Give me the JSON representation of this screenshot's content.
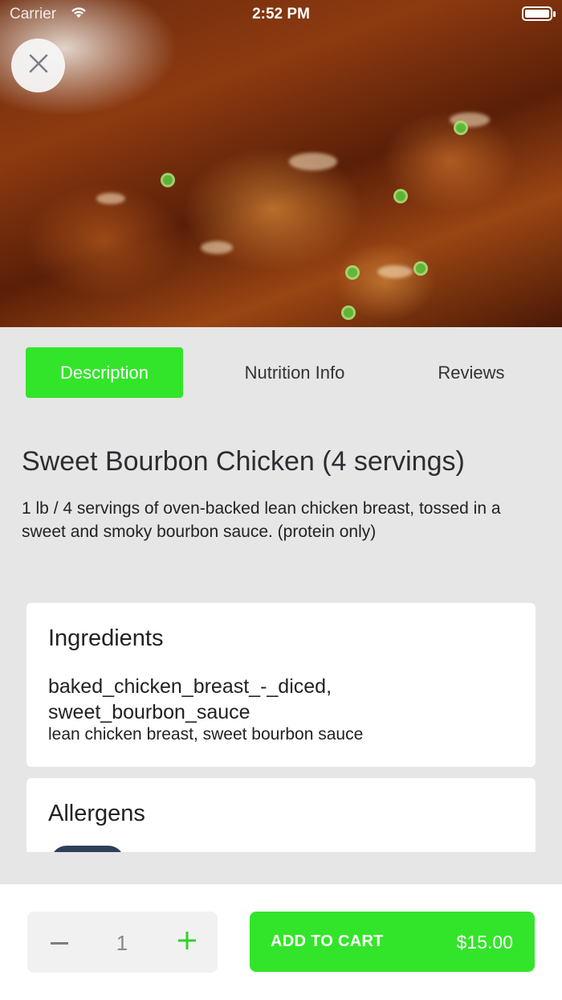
{
  "status_bar": {
    "carrier": "Carrier",
    "time": "2:52 PM"
  },
  "hero": {
    "icon": "food-photo"
  },
  "close_icon": "close-icon",
  "tabs": [
    {
      "label": "Description",
      "active": true
    },
    {
      "label": "Nutrition Info",
      "active": false
    },
    {
      "label": "Reviews",
      "active": false
    }
  ],
  "product": {
    "title": "Sweet Bourbon Chicken (4 servings)",
    "description": "1 lb / 4 servings of oven-backed lean chicken breast, tossed in a sweet and smoky bourbon sauce. (protein only)"
  },
  "ingredients": {
    "heading": "Ingredients",
    "raw": "baked_chicken_breast_-_diced, sweet_bourbon_sauce",
    "readable": "lean chicken breast, sweet bourbon sauce"
  },
  "allergens": {
    "heading": "Allergens"
  },
  "cart": {
    "quantity": "1",
    "add_label": "ADD TO CART",
    "price": "$15.00"
  },
  "colors": {
    "accent": "#33e52a",
    "background": "#e6e6e6"
  }
}
